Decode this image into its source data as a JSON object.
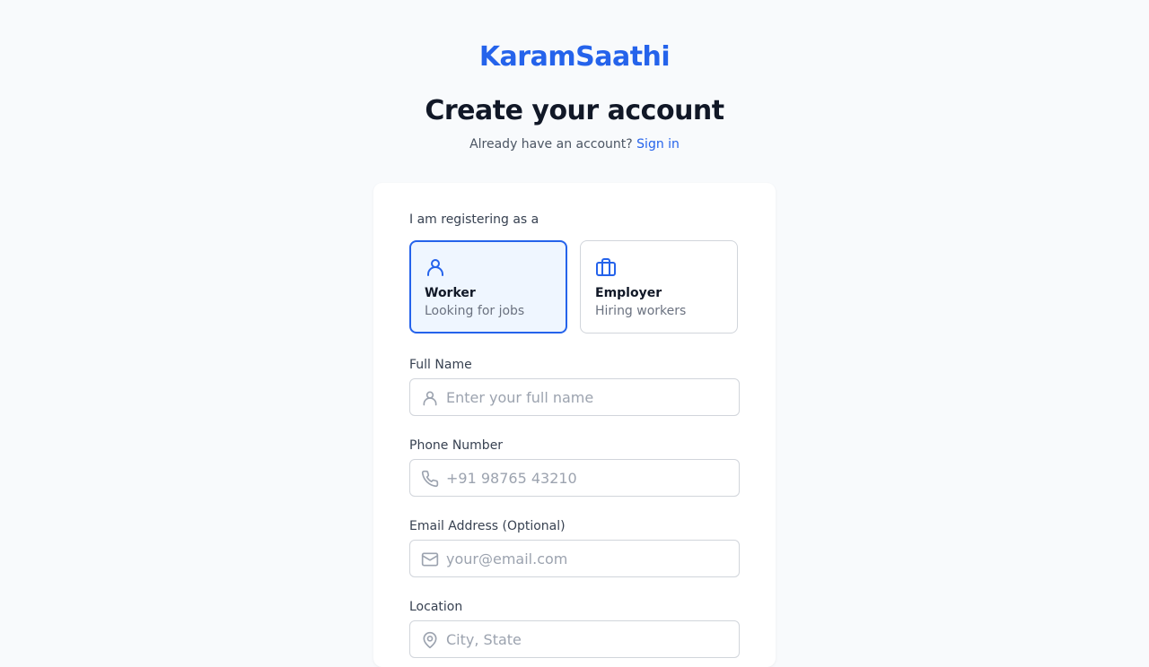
{
  "brand": "KaramSaathi",
  "heading": "Create your account",
  "subtitle": {
    "text": "Already have an account?",
    "link": "Sign in"
  },
  "form": {
    "role_label": "I am registering as a",
    "roles": [
      {
        "title": "Worker",
        "desc": "Looking for jobs",
        "icon": "user-icon",
        "selected": true
      },
      {
        "title": "Employer",
        "desc": "Hiring workers",
        "icon": "briefcase-icon",
        "selected": false
      }
    ],
    "fields": {
      "full_name": {
        "label": "Full Name",
        "placeholder": "Enter your full name",
        "value": "",
        "icon": "user-icon"
      },
      "phone": {
        "label": "Phone Number",
        "placeholder": "+91 98765 43210",
        "value": "",
        "icon": "phone-icon"
      },
      "email": {
        "label": "Email Address (Optional)",
        "placeholder": "your@email.com",
        "value": "",
        "icon": "mail-icon"
      },
      "location": {
        "label": "Location",
        "placeholder": "City, State",
        "value": "",
        "icon": "map-pin-icon"
      }
    }
  },
  "colors": {
    "accent": "#2563eb",
    "background": "#f8fafc",
    "selected_bg": "#eff6ff"
  }
}
